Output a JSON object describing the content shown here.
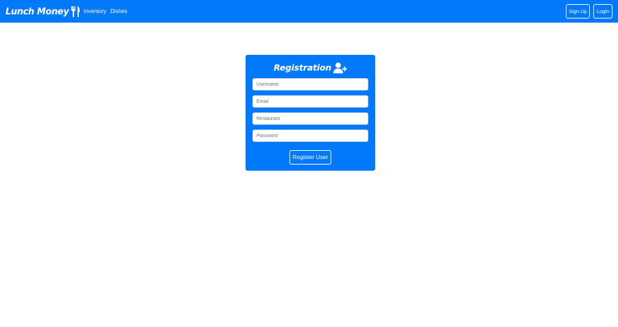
{
  "navbar": {
    "brand": "Lunch Money",
    "brand_icon": "fork-knife-icon",
    "links": [
      "Inventory",
      "Dishes"
    ],
    "signup_label": "Sign Up",
    "login_label": "Login",
    "background": "#0278fb"
  },
  "registration": {
    "title": "Registration",
    "title_icon": "user-plus-icon",
    "fields": [
      {
        "placeholder": "Username",
        "value": ""
      },
      {
        "placeholder": "Email",
        "value": ""
      },
      {
        "placeholder": "Restaurant",
        "value": ""
      },
      {
        "placeholder": "Password",
        "value": ""
      }
    ],
    "submit_label": "Register User",
    "background": "#0278fb"
  }
}
